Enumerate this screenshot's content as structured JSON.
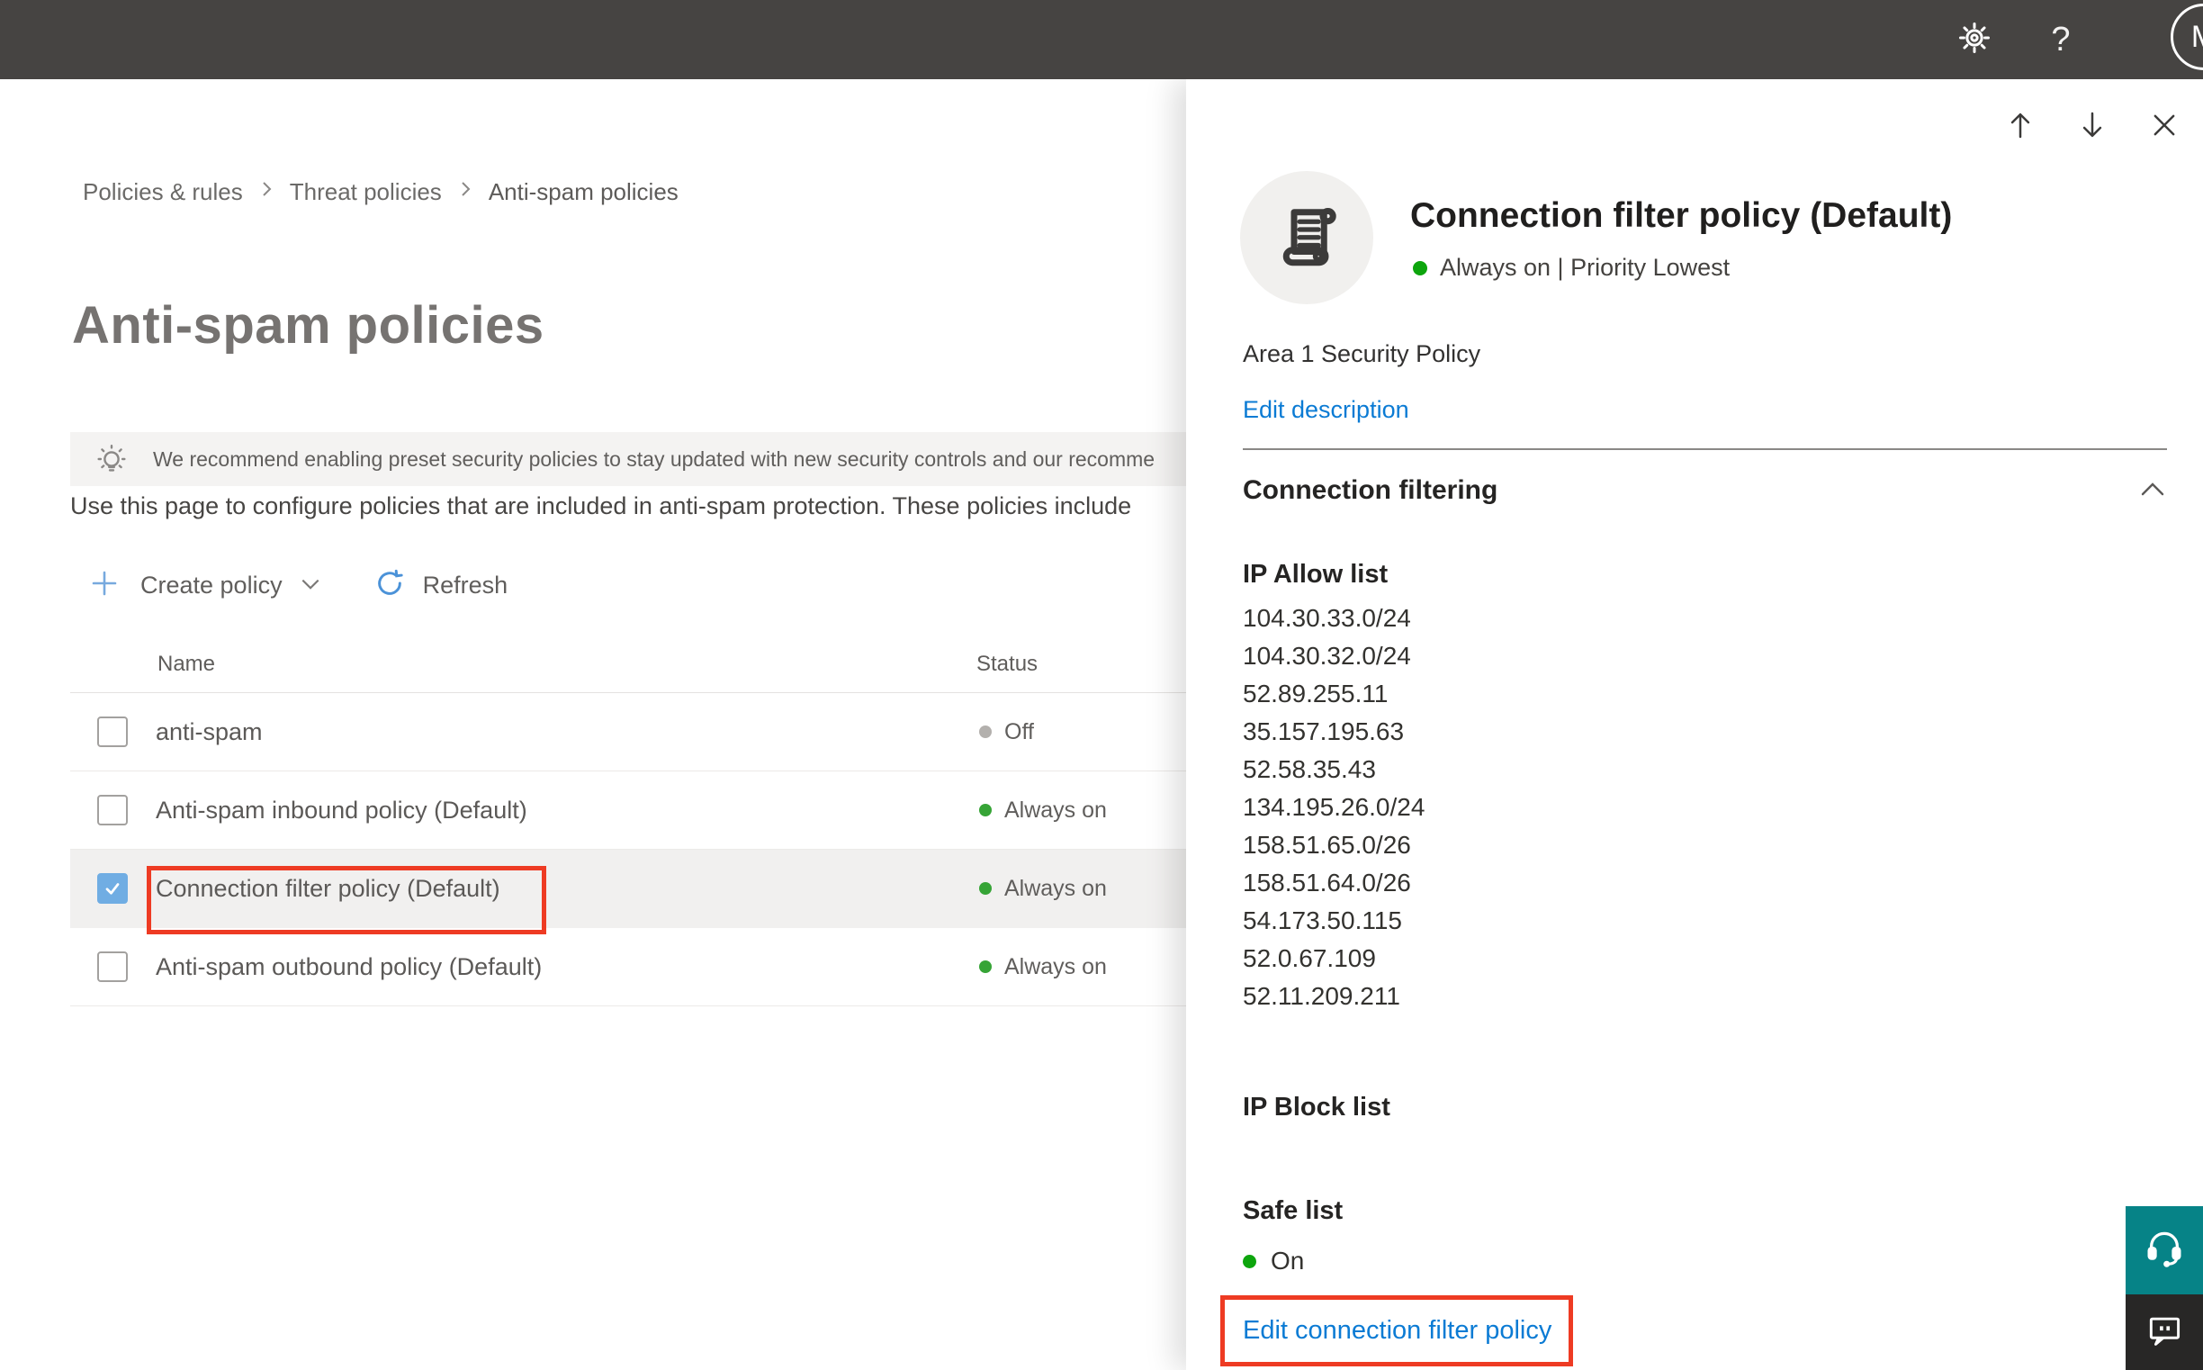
{
  "topbar": {
    "help_label": "?",
    "avatar_initial": "M"
  },
  "breadcrumb": {
    "items": [
      {
        "label": "Policies & rules"
      },
      {
        "label": "Threat policies"
      },
      {
        "label": "Anti-spam policies"
      }
    ]
  },
  "page": {
    "title": "Anti-spam policies",
    "banner": "We recommend enabling preset security policies to stay updated with new security controls and our recomme",
    "description": "Use this page to configure policies that are included in anti-spam protection. These policies include",
    "toolbar": {
      "create_policy": "Create policy",
      "refresh": "Refresh"
    }
  },
  "table": {
    "headers": {
      "name": "Name",
      "status": "Status"
    },
    "rows": [
      {
        "name": "anti-spam",
        "status": "Off"
      },
      {
        "name": "Anti-spam inbound policy (Default)",
        "status": "Always on"
      },
      {
        "name": "Connection filter policy (Default)",
        "status": "Always on"
      },
      {
        "name": "Anti-spam outbound policy (Default)",
        "status": "Always on"
      }
    ]
  },
  "flyout": {
    "title": "Connection filter policy (Default)",
    "status_line": "Always on | Priority Lowest",
    "description": "Area 1 Security Policy",
    "edit_description_link": "Edit description",
    "section_title": "Connection filtering",
    "ip_allow_label": "IP Allow list",
    "ip_allow": [
      "104.30.33.0/24",
      "104.30.32.0/24",
      "52.89.255.11",
      "35.157.195.63",
      "52.58.35.43",
      "134.195.26.0/24",
      "158.51.65.0/26",
      "158.51.64.0/26",
      "54.173.50.115",
      "52.0.67.109",
      "52.11.209.211"
    ],
    "ip_block_label": "IP Block list",
    "safe_list_label": "Safe list",
    "safe_list_status": "On",
    "edit_policy_link": "Edit connection filter policy"
  },
  "colors": {
    "accent_blue": "#0b7bd4",
    "annotation_red": "#ee3b23",
    "status_green": "#0da50d",
    "status_gray": "#b3b0ad",
    "support_teal": "#068387",
    "topbar_gray": "#464442"
  }
}
